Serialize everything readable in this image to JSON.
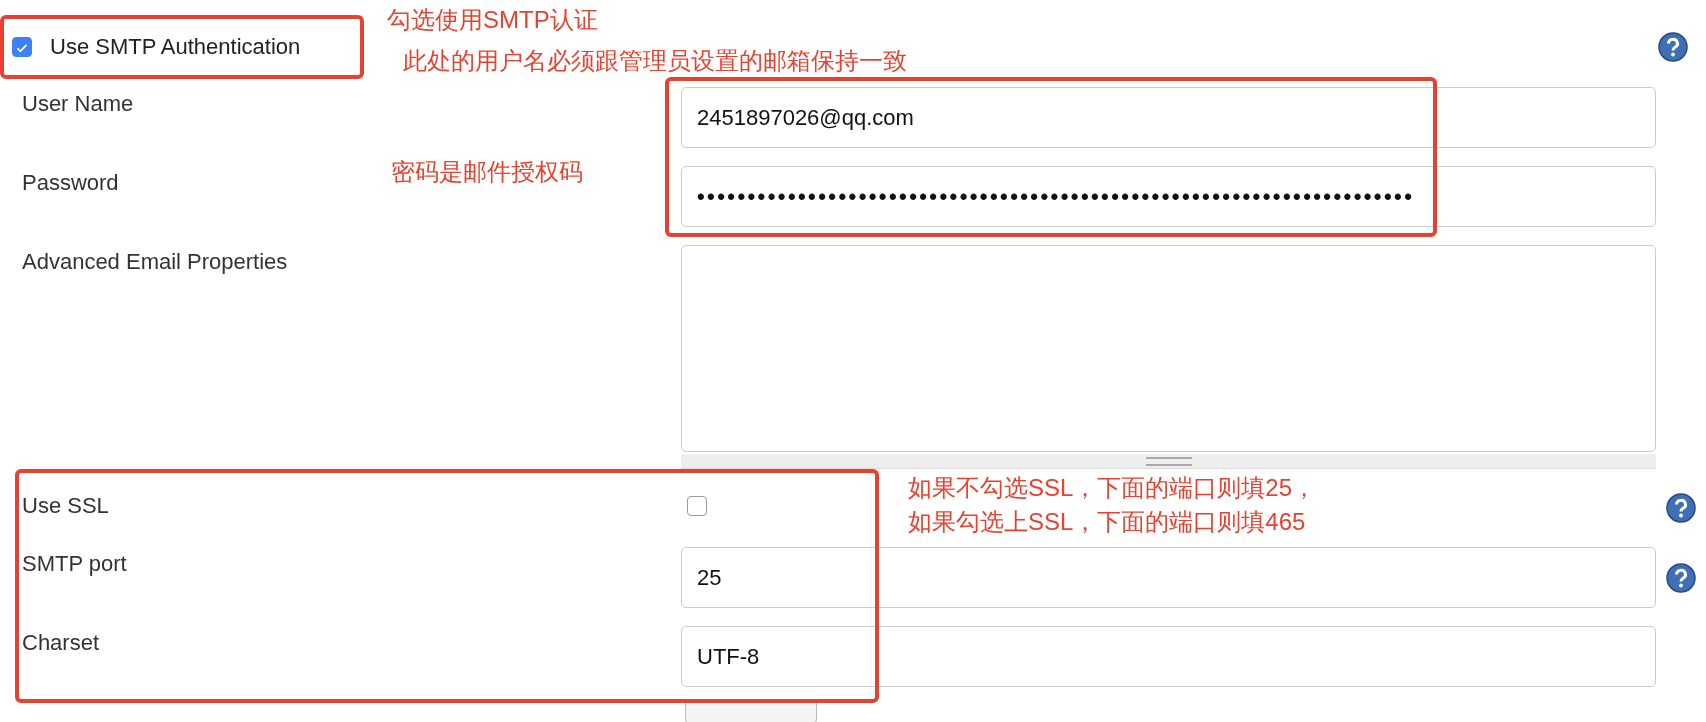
{
  "fields": [
    {
      "kind": "checkbox",
      "label": "Use SMTP Authentication",
      "checked": true,
      "help": true
    },
    {
      "kind": "text",
      "label": "User Name",
      "value": "2451897026@qq.com",
      "help": false
    },
    {
      "kind": "text",
      "label": "Password",
      "value": "•••••••••••••••••••••••••••••••••••••••••••••••••••••••••••••••••••••••",
      "help": false
    },
    {
      "kind": "textarea",
      "label": "Advanced Email Properties",
      "help": false
    },
    {
      "kind": "checkbox",
      "label": "Use SSL",
      "checked": false,
      "help": true
    },
    {
      "kind": "text",
      "label": "SMTP port",
      "value": "25",
      "help": true
    },
    {
      "kind": "text",
      "label": "Charset",
      "value": "UTF-8",
      "help": false
    }
  ],
  "annotations": [
    {
      "text": "勾选使用SMTP认证"
    },
    {
      "text": "此处的用户名必须跟管理员设置的邮箱保持一致"
    },
    {
      "text": "密码是邮件授权码"
    },
    {
      "text": "如果不勾选SSL，下面的端口则填25，"
    },
    {
      "text": "如果勾选上SSL，下面的端口则填465"
    }
  ]
}
